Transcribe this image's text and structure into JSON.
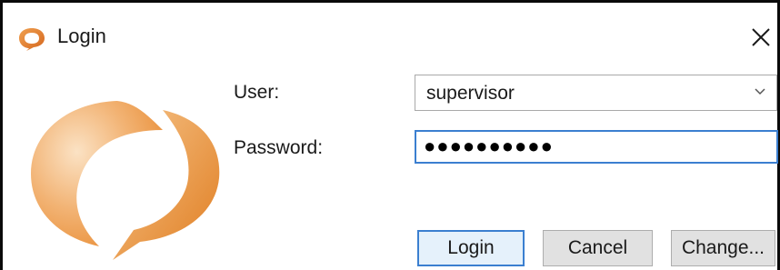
{
  "window": {
    "title": "Login",
    "close_glyph": "✕"
  },
  "icons": {
    "title": "app-logo-icon",
    "close": "close-icon",
    "dropdown": "chevron-down-icon",
    "logo": "speech-bubble-logo"
  },
  "colors": {
    "logo_orange": "#e8903a",
    "focus_blue": "#3b7fd0"
  },
  "form": {
    "user_label": "User:",
    "user_value": "supervisor",
    "password_label": "Password:",
    "password_mask": "●●●●●●●●●●"
  },
  "buttons": {
    "login": "Login",
    "cancel": "Cancel",
    "change": "Change..."
  }
}
